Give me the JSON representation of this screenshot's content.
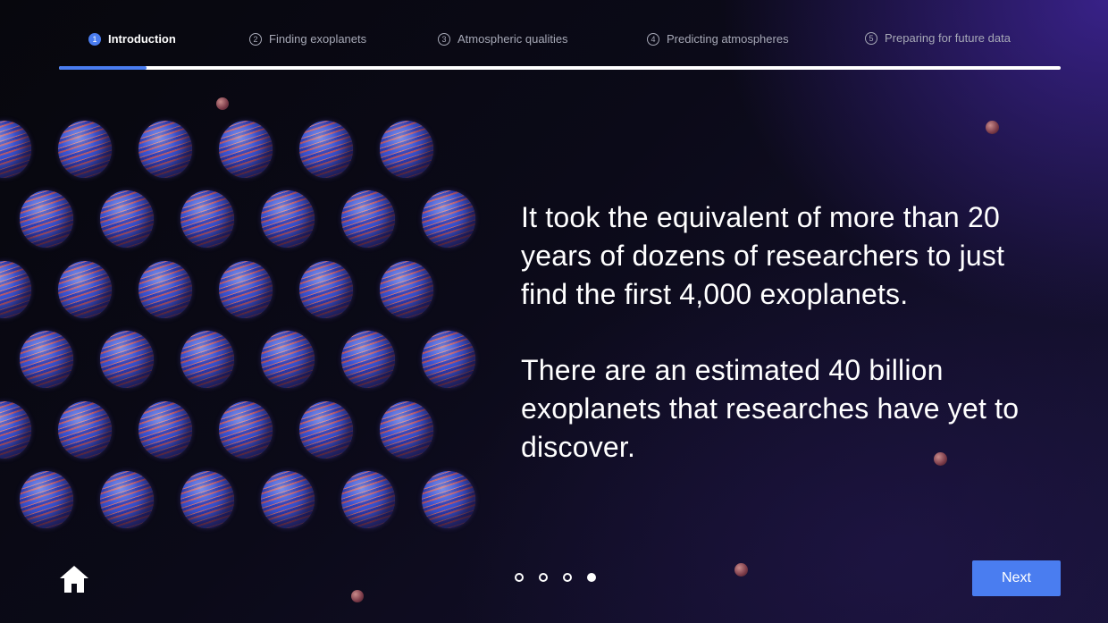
{
  "nav": {
    "steps": [
      {
        "number": "1",
        "label": "Introduction",
        "active": true
      },
      {
        "number": "2",
        "label": "Finding exoplanets",
        "active": false
      },
      {
        "number": "3",
        "label": "Atmospheric qualities",
        "active": false
      },
      {
        "number": "4",
        "label": "Predicting atmospheres",
        "active": false
      },
      {
        "number": "5",
        "label": "Preparing for future data",
        "active": false
      }
    ],
    "progress_fraction": 0.087
  },
  "content": {
    "paragraph1": "It took the equivalent of more than 20 years of dozens of researchers to just find the first 4,000 exoplanets.",
    "paragraph2": "There are an estimated 40 billion exoplanets that researches have yet to discover."
  },
  "footer": {
    "home_icon": "home-icon",
    "pagination": {
      "total": 4,
      "current": 4
    },
    "next_label": "Next"
  },
  "colors": {
    "accent": "#4a7df0",
    "text": "#ffffff",
    "muted": "#a7a9b7"
  }
}
